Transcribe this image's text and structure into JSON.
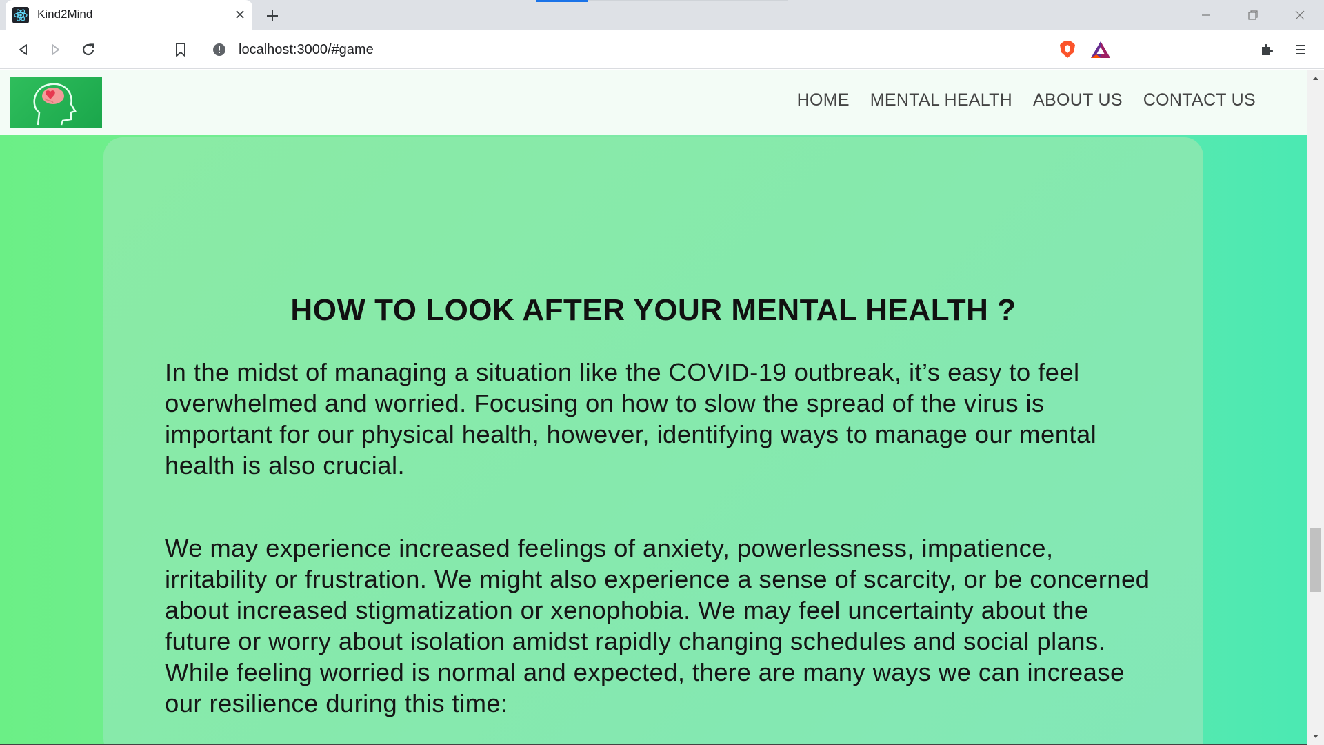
{
  "browser": {
    "tab_title": "Kind2Mind",
    "url": "localhost:3000/#game"
  },
  "nav": {
    "items": [
      {
        "label": "HOME"
      },
      {
        "label": "MENTAL HEALTH"
      },
      {
        "label": "ABOUT US"
      },
      {
        "label": "CONTACT US"
      }
    ]
  },
  "card": {
    "title": "HOW TO LOOK AFTER YOUR MENTAL HEALTH ?",
    "paragraphs": [
      "In the midst of managing a situation like the COVID-19 outbreak, it’s easy to feel overwhelmed and worried. Focusing on how to slow the spread of the virus is important for our physical health, however, identifying ways to manage our mental health is also crucial.",
      "We may experience increased feelings of anxiety, powerlessness, impatience, irritability or frustration. We might also experience a sense of scarcity, or be concerned about increased stigmatization or xenophobia. We may feel uncertainty about the future or worry about isolation amidst rapidly changing schedules and social plans. While feeling worried is normal and expected, there are many ways we can increase our resilience during this time:"
    ]
  },
  "icons": {
    "favicon": "react-icon",
    "logo": "brain-heart-head-icon",
    "omnibox_info": "info-icon",
    "brave": "brave-lion-icon",
    "rewards": "bat-triangle-icon"
  },
  "colors": {
    "page_gradient_start": "#6bef86",
    "page_gradient_end": "#4be9b2",
    "card": "#86e9ad",
    "nav_bg": "#f3fcf6",
    "logo_bg": "#1fae50"
  }
}
